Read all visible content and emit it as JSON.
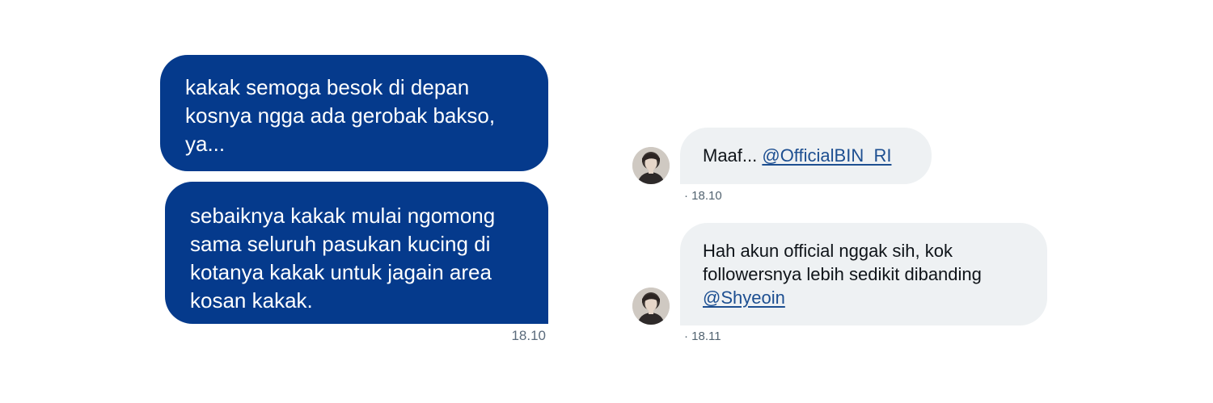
{
  "outgoing": {
    "message_1": "kakak semoga besok di depan\nkosnya ngga ada gerobak bakso,\nya...",
    "message_2": "sebaiknya kakak mulai ngomong\nsama seluruh pasukan kucing di\nkotanya kakak untuk jagain area\nkosan kakak.",
    "timestamp": "18.10",
    "bubble_color": "#053a8c"
  },
  "incoming": [
    {
      "text": "Maaf... ",
      "mention": "@OfficialBIN_RI",
      "timestamp": "· 18.10",
      "avatar_icon": "user-avatar"
    },
    {
      "text": "Hah akun official nggak sih, kok followersnya lebih sedikit dibanding ",
      "mention": "@Shyeoin",
      "timestamp": "· 18.11",
      "avatar_icon": "user-avatar"
    }
  ],
  "colors": {
    "incoming_bubble": "#eef1f3",
    "mention_link": "#1d4f91"
  }
}
